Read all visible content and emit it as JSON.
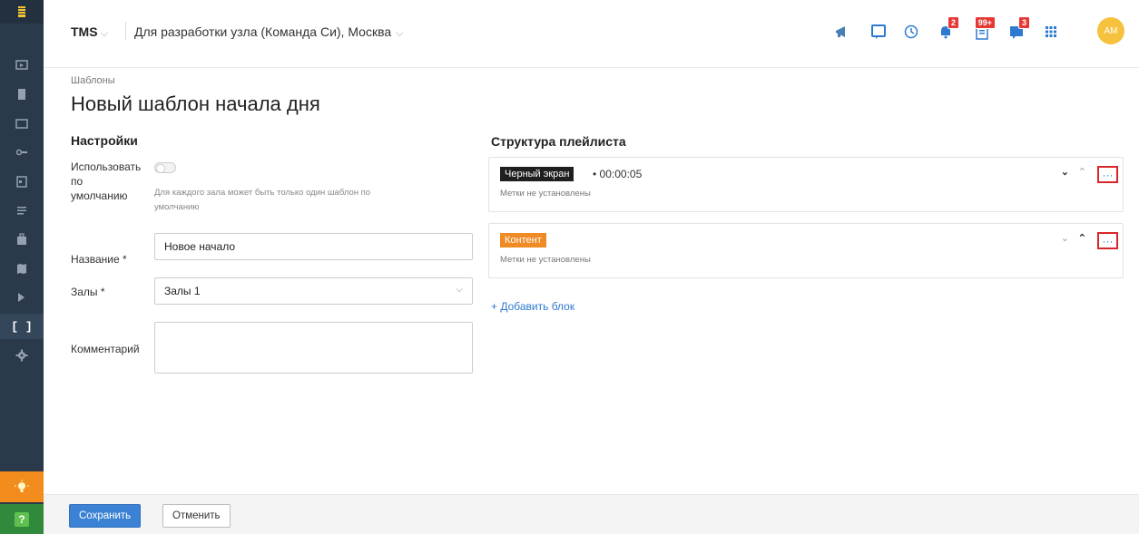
{
  "topbar": {
    "app_name": "TMS",
    "context": "Для разработки узла (Команда Си), Москва",
    "badges": {
      "bell": "2",
      "tasks": "99+",
      "messages": "3"
    },
    "avatar_initials": "AM"
  },
  "breadcrumb": "Шаблоны",
  "page_title": "Новый шаблон начала дня",
  "settings": {
    "heading": "Настройки",
    "default_label_l1": "Использовать",
    "default_label_l2": "по",
    "default_label_l3": "умолчанию",
    "default_hint_l1": "Для каждого зала может быть только один шаблон по",
    "default_hint_l2": "умолчанию",
    "name_label": "Название",
    "name_value": "Новое начало",
    "halls_label": "Залы",
    "halls_value": "Залы 1",
    "comment_label": "Комментарий",
    "comment_value": "",
    "required_mark": "*"
  },
  "structure": {
    "heading": "Структура плейлиста",
    "blocks": [
      {
        "tag": "Черный экран",
        "duration": "• 00:00:05",
        "labels": "Метки не установлены"
      },
      {
        "tag": "Контент",
        "duration": "",
        "labels": "Метки не установлены"
      }
    ],
    "add_block": "+ Добавить блок"
  },
  "footer": {
    "save_label": "Сохранить",
    "cancel_label": "Отменить"
  },
  "colors": {
    "sidebar": "#2b3a4a",
    "accent": "#2e7ad1",
    "badge": "#e53935",
    "tag_black": "#1f1f1f",
    "tag_orange": "#f08a24",
    "highlight": "#d9262a"
  }
}
